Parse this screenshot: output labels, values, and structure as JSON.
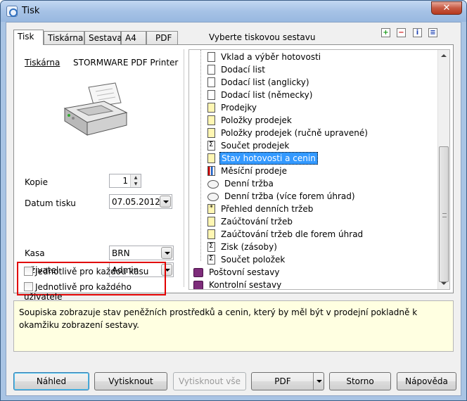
{
  "window": {
    "title": "Tisk",
    "close_label": "✕"
  },
  "tabs": [
    {
      "label": "Tisk"
    },
    {
      "label": "Tiskárna"
    },
    {
      "label": "Sestava"
    },
    {
      "label": "A4"
    },
    {
      "label": "PDF"
    }
  ],
  "select_label": "Vyberte tiskovou sestavu",
  "toolbar_icons": [
    "add-icon",
    "remove-icon",
    "info-icon",
    "properties-icon"
  ],
  "left": {
    "printer_label": "Tiskárna",
    "printer_name": "STORMWARE PDF Printer",
    "copies_label": "Kopie",
    "copies_value": "1",
    "date_label": "Datum tisku",
    "date_value": "07.05.2012",
    "register_label": "Kasa",
    "register_value": "BRN",
    "user_label": "Uživatel",
    "user_value": "Admin",
    "each_register_label": "Jednotlivě pro každou kasu",
    "each_user_label": "Jednotlivě pro každého uživatele"
  },
  "tree": {
    "items": [
      {
        "label": "Vklad a výběr hotovosti",
        "icon": "document-icon"
      },
      {
        "label": "Dodací list",
        "icon": "document-icon"
      },
      {
        "label": "Dodací list (anglicky)",
        "icon": "document-icon"
      },
      {
        "label": "Dodací list (německy)",
        "icon": "document-icon"
      },
      {
        "label": "Prodejky",
        "icon": "yellow-document-icon"
      },
      {
        "label": "Položky prodejek",
        "icon": "yellow-document-icon"
      },
      {
        "label": "Položky prodejek (ručně upravené)",
        "icon": "yellow-document-icon"
      },
      {
        "label": "Součet prodejek",
        "icon": "sigma-icon"
      },
      {
        "label": "Stav hotovosti a cenin",
        "icon": "yellow-document-icon"
      },
      {
        "label": "Měsíční prodeje",
        "icon": "chart-icon"
      },
      {
        "label": "Denní tržba",
        "icon": "disk-icon"
      },
      {
        "label": "Denní tržba (více forem úhrad)",
        "icon": "disk-icon"
      },
      {
        "label": "Přehled denních tržeb",
        "icon": "star-document-icon"
      },
      {
        "label": "Zaúčtování tržeb",
        "icon": "yellow-document-icon"
      },
      {
        "label": "Zaúčtování tržeb dle forem úhrad",
        "icon": "yellow-document-icon"
      },
      {
        "label": "Zisk (zásoby)",
        "icon": "sigma-icon"
      },
      {
        "label": "Součet položek",
        "icon": "sigma-icon"
      }
    ],
    "groups": [
      {
        "label": "Poštovní sestavy",
        "icon": "book-icon"
      },
      {
        "label": "Kontrolní sestavy",
        "icon": "book-icon"
      }
    ],
    "selected": "Stav hotovosti a cenin"
  },
  "description": "Soupiska zobrazuje stav peněžních prostředků a cenin, který by měl být v prodejní pokladně k okamžiku zobrazení sestavy.",
  "buttons": {
    "preview": "Náhled",
    "print": "Vytisknout",
    "print_all": "Vytisknout vše",
    "pdf": "PDF",
    "cancel": "Storno",
    "help": "Nápověda"
  },
  "colors": {
    "selection": "#3399ff",
    "highlight_box": "#e10000",
    "description_bg": "#ffffe1"
  }
}
